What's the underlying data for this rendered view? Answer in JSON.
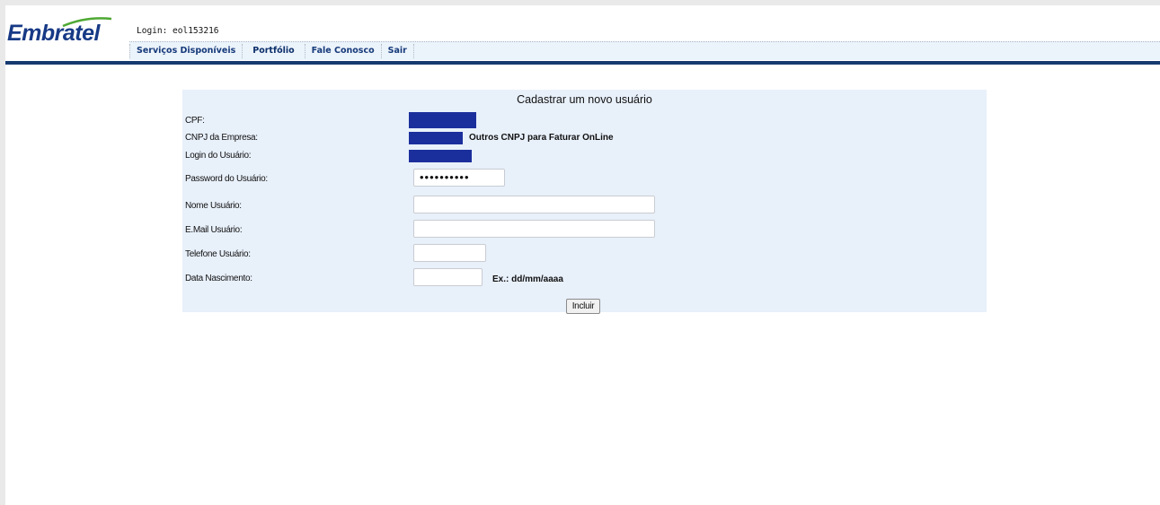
{
  "header": {
    "logo_text": "Embratel",
    "login_text": "Login: eol153216"
  },
  "nav": {
    "items": [
      "Serviços Disponíveis",
      "Portfólio",
      "Fale Conosco",
      "Sair"
    ]
  },
  "form": {
    "title": "Cadastrar um novo usuário",
    "labels": {
      "cpf": "CPF:",
      "cnpj": "CNPJ da Empresa:",
      "login": "Login do Usuário:",
      "password": "Password do Usuário:",
      "name": "Nome Usuário:",
      "email": "E.Mail Usuário:",
      "phone": "Telefone Usuário:",
      "birth": "Data Nascimento:"
    },
    "cnpj_extra": "Outros CNPJ para Faturar OnLine",
    "password_value": "••••••••••",
    "name_value": "",
    "email_value": "",
    "phone_value": "",
    "birth_value": "",
    "birth_hint": "Ex.: dd/mm/aaaa",
    "submit_label": "Incluir"
  },
  "colors": {
    "brand": "#173a86",
    "nav_bg": "#ebf3fb",
    "rule": "#163a70",
    "form_bg": "#e8f0fa",
    "redaction": "#1b2f9c"
  }
}
